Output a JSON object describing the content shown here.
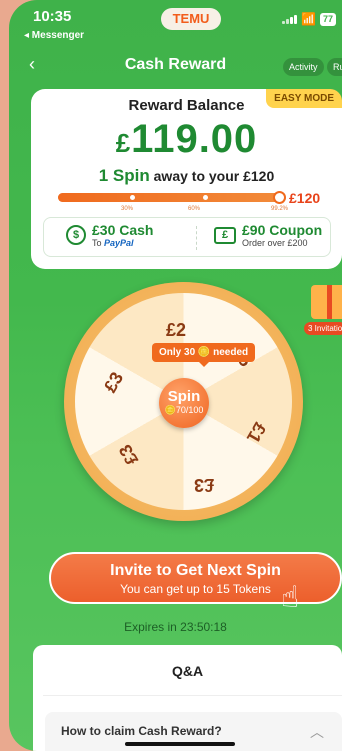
{
  "status": {
    "time": "10:35",
    "back_app": "◂ Messenger",
    "battery": "77"
  },
  "header": {
    "brand": "TEMU",
    "title": "Cash Reward",
    "chips": [
      "Activity",
      "Ru"
    ],
    "back_icon": "chevron-left-icon"
  },
  "balance_card": {
    "mode_badge": "EASY MODE",
    "label": "Reward Balance",
    "currency": "£",
    "amount": "119.00",
    "spins_count": "1 Spin",
    "spins_text": "away to your £120",
    "progress_fraction": 0.992,
    "target": "£120",
    "milestones": [
      "30%",
      "60%",
      "99.2%"
    ],
    "rewards": [
      {
        "icon": "dollar-icon",
        "title": "£30 Cash",
        "sub_prefix": "To ",
        "sub_brand": "PayPal"
      },
      {
        "icon": "ticket-icon",
        "title": "£90 Coupon",
        "sub": "Order over £200"
      }
    ]
  },
  "wheel": {
    "segments": [
      "£2",
      "£5",
      "£1",
      "£3",
      "£3",
      "£3"
    ],
    "tooltip": "Only 30 🪙 needed",
    "spin_label": "Spin",
    "spin_count": "🪙70/100"
  },
  "gift": {
    "badge": "3 Invitatio"
  },
  "invite": {
    "title": "Invite to Get Next Spin",
    "subtitle": "You can get up to 15 Tokens"
  },
  "expires": "Expires in 23:50:18",
  "qa": {
    "title": "Q&A",
    "question": "How to claim Cash Reward?"
  },
  "colors": {
    "accent": "#f06a1e",
    "green": "#1f8a32",
    "bg": "#43b84d"
  }
}
